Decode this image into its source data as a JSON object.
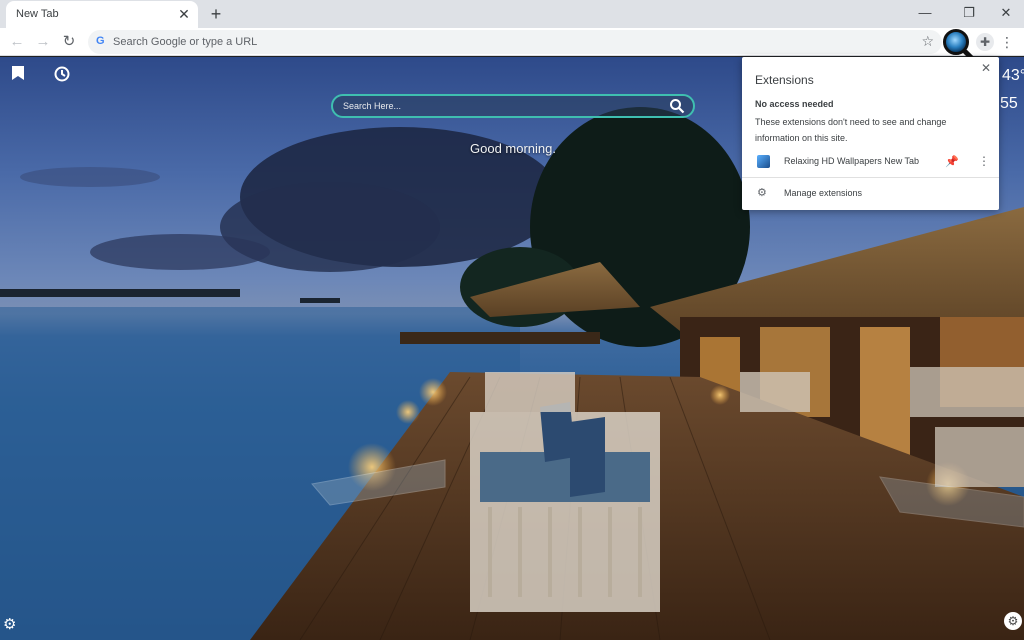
{
  "browser": {
    "tab_title": "New Tab",
    "tab_close": "✕",
    "new_tab": "+",
    "window_controls": {
      "minimize": "—",
      "restore": "❐",
      "close": "✕"
    },
    "omnibox_placeholder": "Search Google or type a URL",
    "omnibox_logo": "G",
    "nav": {
      "back": "←",
      "forward": "→",
      "reload": "↻"
    }
  },
  "ntp": {
    "search_placeholder": "Search Here...",
    "greeting": "Good morning.",
    "weather_temp": "43°",
    "weather_sub": "55",
    "icons": [
      "bookmark-icon",
      "history-icon",
      "settings-icon"
    ]
  },
  "extensions_popup": {
    "title": "Extensions",
    "section_title": "No access needed",
    "description": "These extensions don't need to see and change information on this site.",
    "extension_name": "Relaxing HD Wallpapers New Tab",
    "manage_label": "Manage extensions",
    "close": "✕"
  },
  "colors": {
    "search_border": "#3fbfb0",
    "pin": "#1a73e8"
  }
}
